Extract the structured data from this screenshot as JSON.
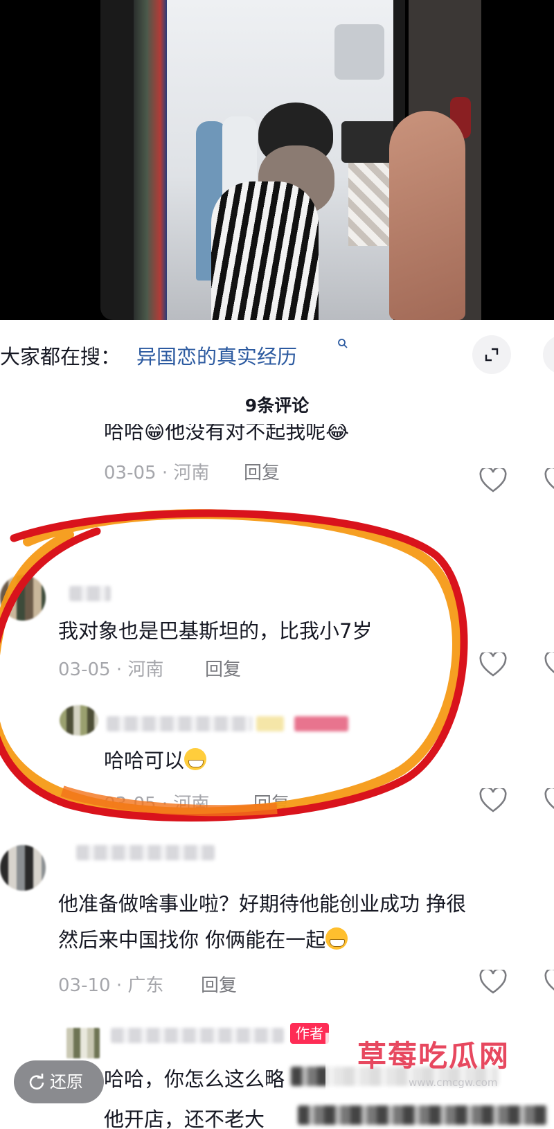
{
  "search": {
    "prefix": "大家都在搜：",
    "term": "异国恋的真实经历"
  },
  "comments_header": {
    "count_label": "9条评论"
  },
  "comments": [
    {
      "text": "哈哈😁他没有对不起我呢😂",
      "date": "03-05 · 河南",
      "reply_label": "回复"
    },
    {
      "text": "我对象也是巴基斯坦的，比我小7岁",
      "date": "03-05 · 河南",
      "reply_label": "回复",
      "reply": {
        "text": "哈哈可以",
        "date": "03-05 · 河南",
        "reply_label": "回复"
      }
    },
    {
      "line1": "他准备做啥事业啦？好期待他能创业成功 挣很",
      "line2": "然后来中国找你 你俩能在一起",
      "date": "03-10 · 广东",
      "reply_label": "回复"
    },
    {
      "author_badge": "作者",
      "line1": "哈哈，你怎么这么略",
      "line2": "他开店，还不老大"
    }
  ],
  "restore_button": {
    "label": "还原"
  },
  "watermark": {
    "title": "草莓吃瓜网",
    "url": "www.cmcgw.com"
  },
  "colors": {
    "accent_blue": "#2c5aa0",
    "author_badge": "#fe2c55",
    "highlight_red": "#d9131c",
    "highlight_orange": "#f59a16"
  }
}
